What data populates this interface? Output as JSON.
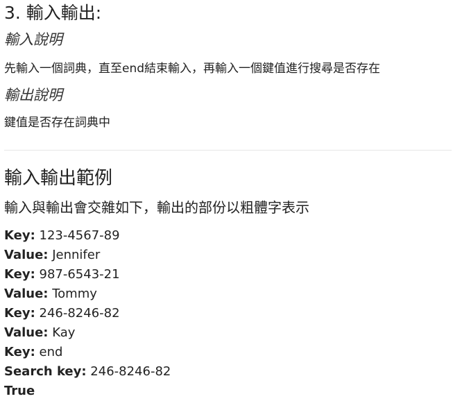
{
  "section": {
    "title": "3. 輸入輸出:"
  },
  "input_desc": {
    "heading": "輸入說明",
    "text": "先輸入一個詞典，直至end結束輸入，再輸入一個鍵值進行搜尋是否存在"
  },
  "output_desc": {
    "heading": "輸出說明",
    "text": "鍵值是否存在詞典中"
  },
  "example": {
    "title": "輸入輸出範例",
    "description": "輸入與輸出會交雜如下，輸出的部份以粗體字表示",
    "lines": [
      {
        "label": "Key:",
        "value": " 123-4567-89"
      },
      {
        "label": "Value:",
        "value": " Jennifer"
      },
      {
        "label": "Key:",
        "value": " 987-6543-21"
      },
      {
        "label": "Value:",
        "value": " Tommy"
      },
      {
        "label": "Key:",
        "value": " 246-8246-82"
      },
      {
        "label": "Value:",
        "value": " Kay"
      },
      {
        "label": "Key:",
        "value": " end"
      },
      {
        "label": "Search key:",
        "value": " 246-8246-82"
      },
      {
        "label": "True",
        "value": ""
      }
    ]
  }
}
